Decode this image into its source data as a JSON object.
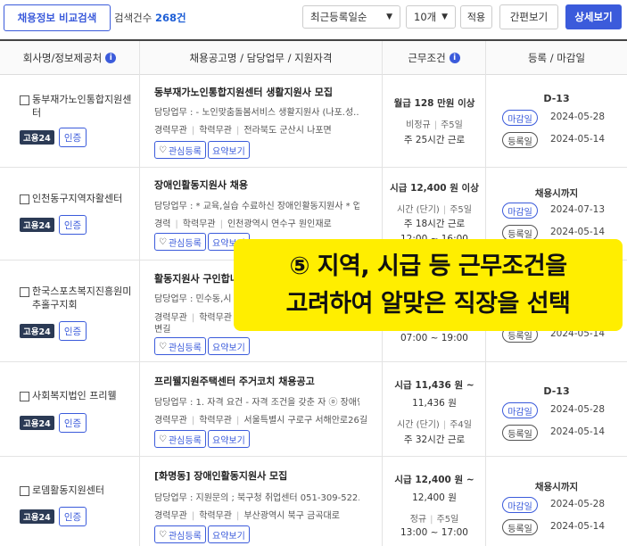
{
  "toolbar": {
    "compare_label": "채용정보 비교검색",
    "count_label": "검색건수",
    "count_value": "268건",
    "sort_selected": "최근등록일순",
    "page_size_selected": "10개",
    "apply_label": "적용",
    "simple_view_label": "간편보기",
    "detail_view_label": "상세보기"
  },
  "columns": {
    "company": "회사명/정보제공처",
    "title": "채용공고명 / 담당업무 / 지원자격",
    "condition": "근무조건",
    "dates": "등록 / 마감일"
  },
  "labels": {
    "goyong24": "고용24",
    "cert": "인증",
    "fav": "관심등록",
    "summary": "요약보기",
    "due": "마감일",
    "registered": "등록일"
  },
  "rows": [
    {
      "company": "동부재가노인통합지원센터",
      "title": "동부재가노인통합지원센터 생활지원사 모집",
      "duty": "담당업무 : - 노인맞춤돌봄서비스 생활지원사 (나포.성...",
      "career": "경력무관",
      "education": "학력무관",
      "location": "전라북도 군산시 나포면",
      "pay": "월급 128 만원 이상",
      "employment": "비정규",
      "days": "주5일",
      "hours": "주 25시간 근로",
      "dday": "D-13",
      "due_date": "2024-05-28",
      "reg_date": "2024-05-14"
    },
    {
      "company": "인천동구지역자활센터",
      "title": "장애인활동지원사 채용",
      "duty": "담당업무 : * 교육,실습 수료하신 장애인활동지원사 * 업...",
      "career": "경력",
      "education": "학력무관",
      "location": "인천광역시 연수구 원인재로",
      "pay": "시급 12,400 원 이상",
      "employment": "시간 (단기)",
      "days": "주5일",
      "hours": "주 18시간 근로",
      "time": "12:00 ~ 16:00",
      "until": "채용시까지",
      "due_date": "2024-07-13",
      "reg_date": "2024-05-14"
    },
    {
      "company": "한국스포츠복지진흥원미추홀구지회",
      "title": "활동지원사 구인합니",
      "duty": "담당업무 : 민수동,시",
      "career": "경력무관",
      "education": "학력무관",
      "location_extra": "변길",
      "time": "07:00 ~ 19:00",
      "reg_date": "2024-05-14"
    },
    {
      "company": "사회복지법인 프리웰",
      "title": "프리웰지원주택센터 주거코치 채용공고",
      "duty": "담당업무 : 1. 자격 요건 - 자격 조건을 갖춘 자 ⓞ 장애인...",
      "career": "경력무관",
      "education": "학력무관",
      "location": "서울특별시 구로구 서해안로26길",
      "pay": "시급 11,436 원 ~",
      "pay2": "11,436 원",
      "employment": "시간 (단기)",
      "days": "주4일",
      "hours": "주 32시간 근로",
      "dday": "D-13",
      "due_date": "2024-05-28",
      "reg_date": "2024-05-14"
    },
    {
      "company": "로뎀활동지원센터",
      "title": "[화명동] 장애인활동지원사 모집",
      "duty": "담당업무 : 지원문의 ; 북구청 취업센터 051-309-522...",
      "career": "경력무관",
      "education": "학력무관",
      "location": "부산광역시 북구 금곡대로",
      "pay": "시급 12,400 원 ~",
      "pay2": "12,400 원",
      "employment": "정규",
      "days": "주5일",
      "time": "13:00 ~ 17:00",
      "until": "채용시까지",
      "due_date": "2024-05-28",
      "reg_date": "2024-05-14"
    }
  ],
  "overlay": {
    "line1": "⑤ 지역, 시급 등 근무조건을",
    "line2": "고려하여 알맞은 직장을 선택"
  },
  "colors": {
    "accent": "#3b5bdb",
    "badge_dark": "#2b3a55",
    "highlight": "#ffee00"
  }
}
